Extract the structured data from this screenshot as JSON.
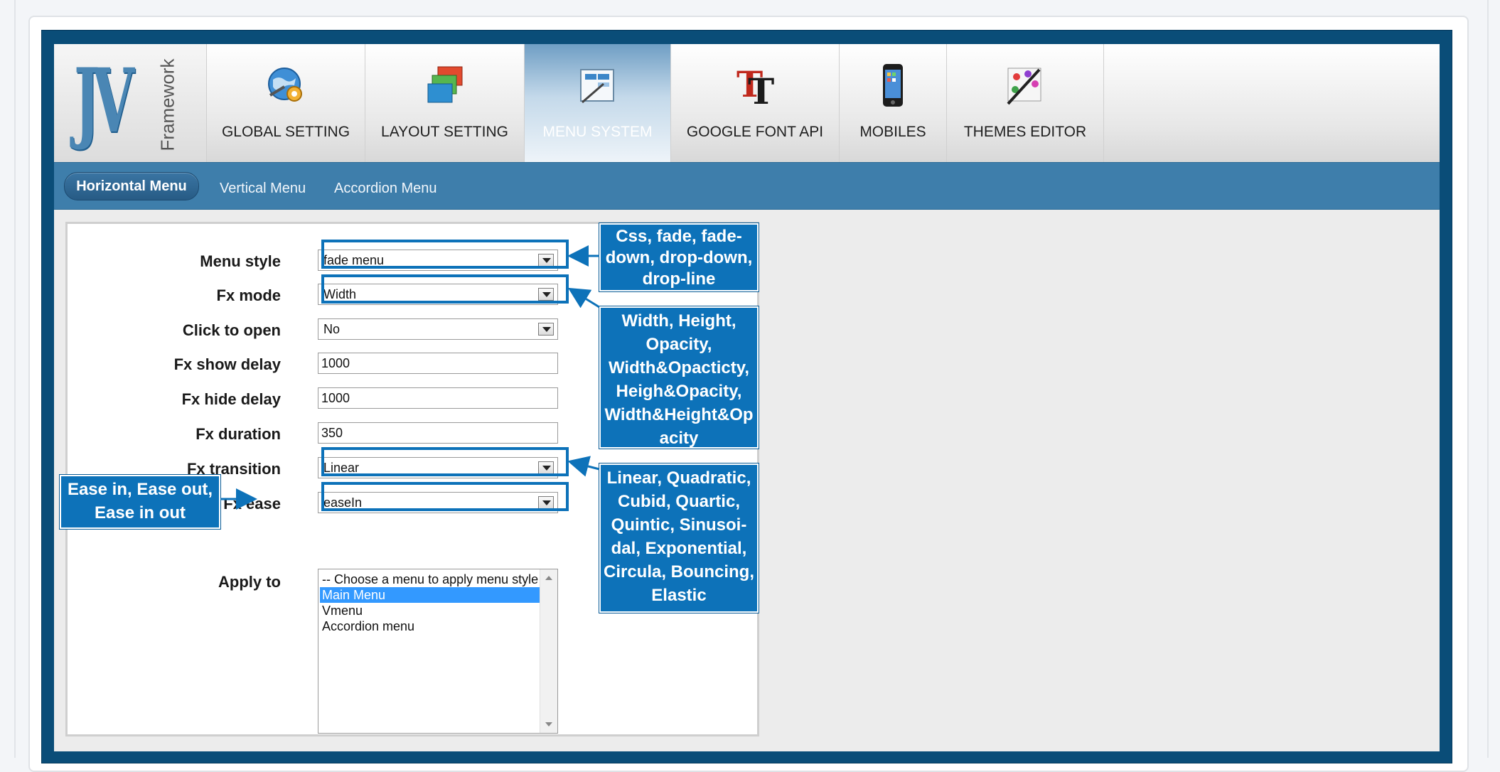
{
  "logo": {
    "brand": "JV",
    "subtitle": "Framework"
  },
  "tabs": [
    {
      "label": "GLOBAL SETTING",
      "icon": "globe-gear-icon",
      "active": false
    },
    {
      "label": "LAYOUT SETTING",
      "icon": "layout-windows-icon",
      "active": false
    },
    {
      "label": "MENU SYSTEM",
      "icon": "menu-edit-icon",
      "active": true
    },
    {
      "label": "GOOGLE FONT API",
      "icon": "font-tt-icon",
      "active": false
    },
    {
      "label": "MOBILES",
      "icon": "mobile-phone-icon",
      "active": false
    },
    {
      "label": "THEMES EDITOR",
      "icon": "paint-palette-icon",
      "active": false
    }
  ],
  "subnav": {
    "active": "Horizontal Menu",
    "items": [
      "Vertical Menu",
      "Accordion Menu"
    ]
  },
  "form": {
    "menu_style": {
      "label": "Menu style",
      "value": "fade menu"
    },
    "fx_mode": {
      "label": "Fx mode",
      "value": "Width"
    },
    "click_to_open": {
      "label": "Click to open",
      "value": "No"
    },
    "fx_show_delay": {
      "label": "Fx show delay",
      "value": "1000"
    },
    "fx_hide_delay": {
      "label": "Fx hide delay",
      "value": "1000"
    },
    "fx_duration": {
      "label": "Fx duration",
      "value": "350"
    },
    "fx_transition": {
      "label": "Fx transition",
      "value": "Linear"
    },
    "fx_ease": {
      "label": "Fx ease",
      "value": "easeIn"
    },
    "apply_to": {
      "label": "Apply to",
      "options": [
        "-- Choose a menu to apply menu style --",
        "Main Menu",
        "Vmenu",
        "Accordion menu"
      ],
      "selected": "Main Menu"
    }
  },
  "callouts": {
    "menu_style": [
      "Css, fade, fade-",
      "down, drop-down,",
      "drop-line"
    ],
    "fx_mode": [
      "Width, Height,",
      "Opacity,",
      "Width&Opacticty,",
      "Heigh&Opacity,",
      "Width&Height&Op",
      "acity"
    ],
    "fx_transition": [
      "Linear, Quadratic,",
      "Cubid, Quartic,",
      "Quintic, Sinusoi-",
      "dal, Exponential,",
      "Circula, Bouncing,",
      "Elastic"
    ],
    "fx_ease": [
      "Ease in, Ease out,",
      "Ease in out"
    ]
  },
  "colors": {
    "frame_blue": "#0a4d78",
    "subnav_blue": "#3e7eab",
    "callout_blue": "#0d72b9",
    "selection_blue": "#3399ff"
  }
}
